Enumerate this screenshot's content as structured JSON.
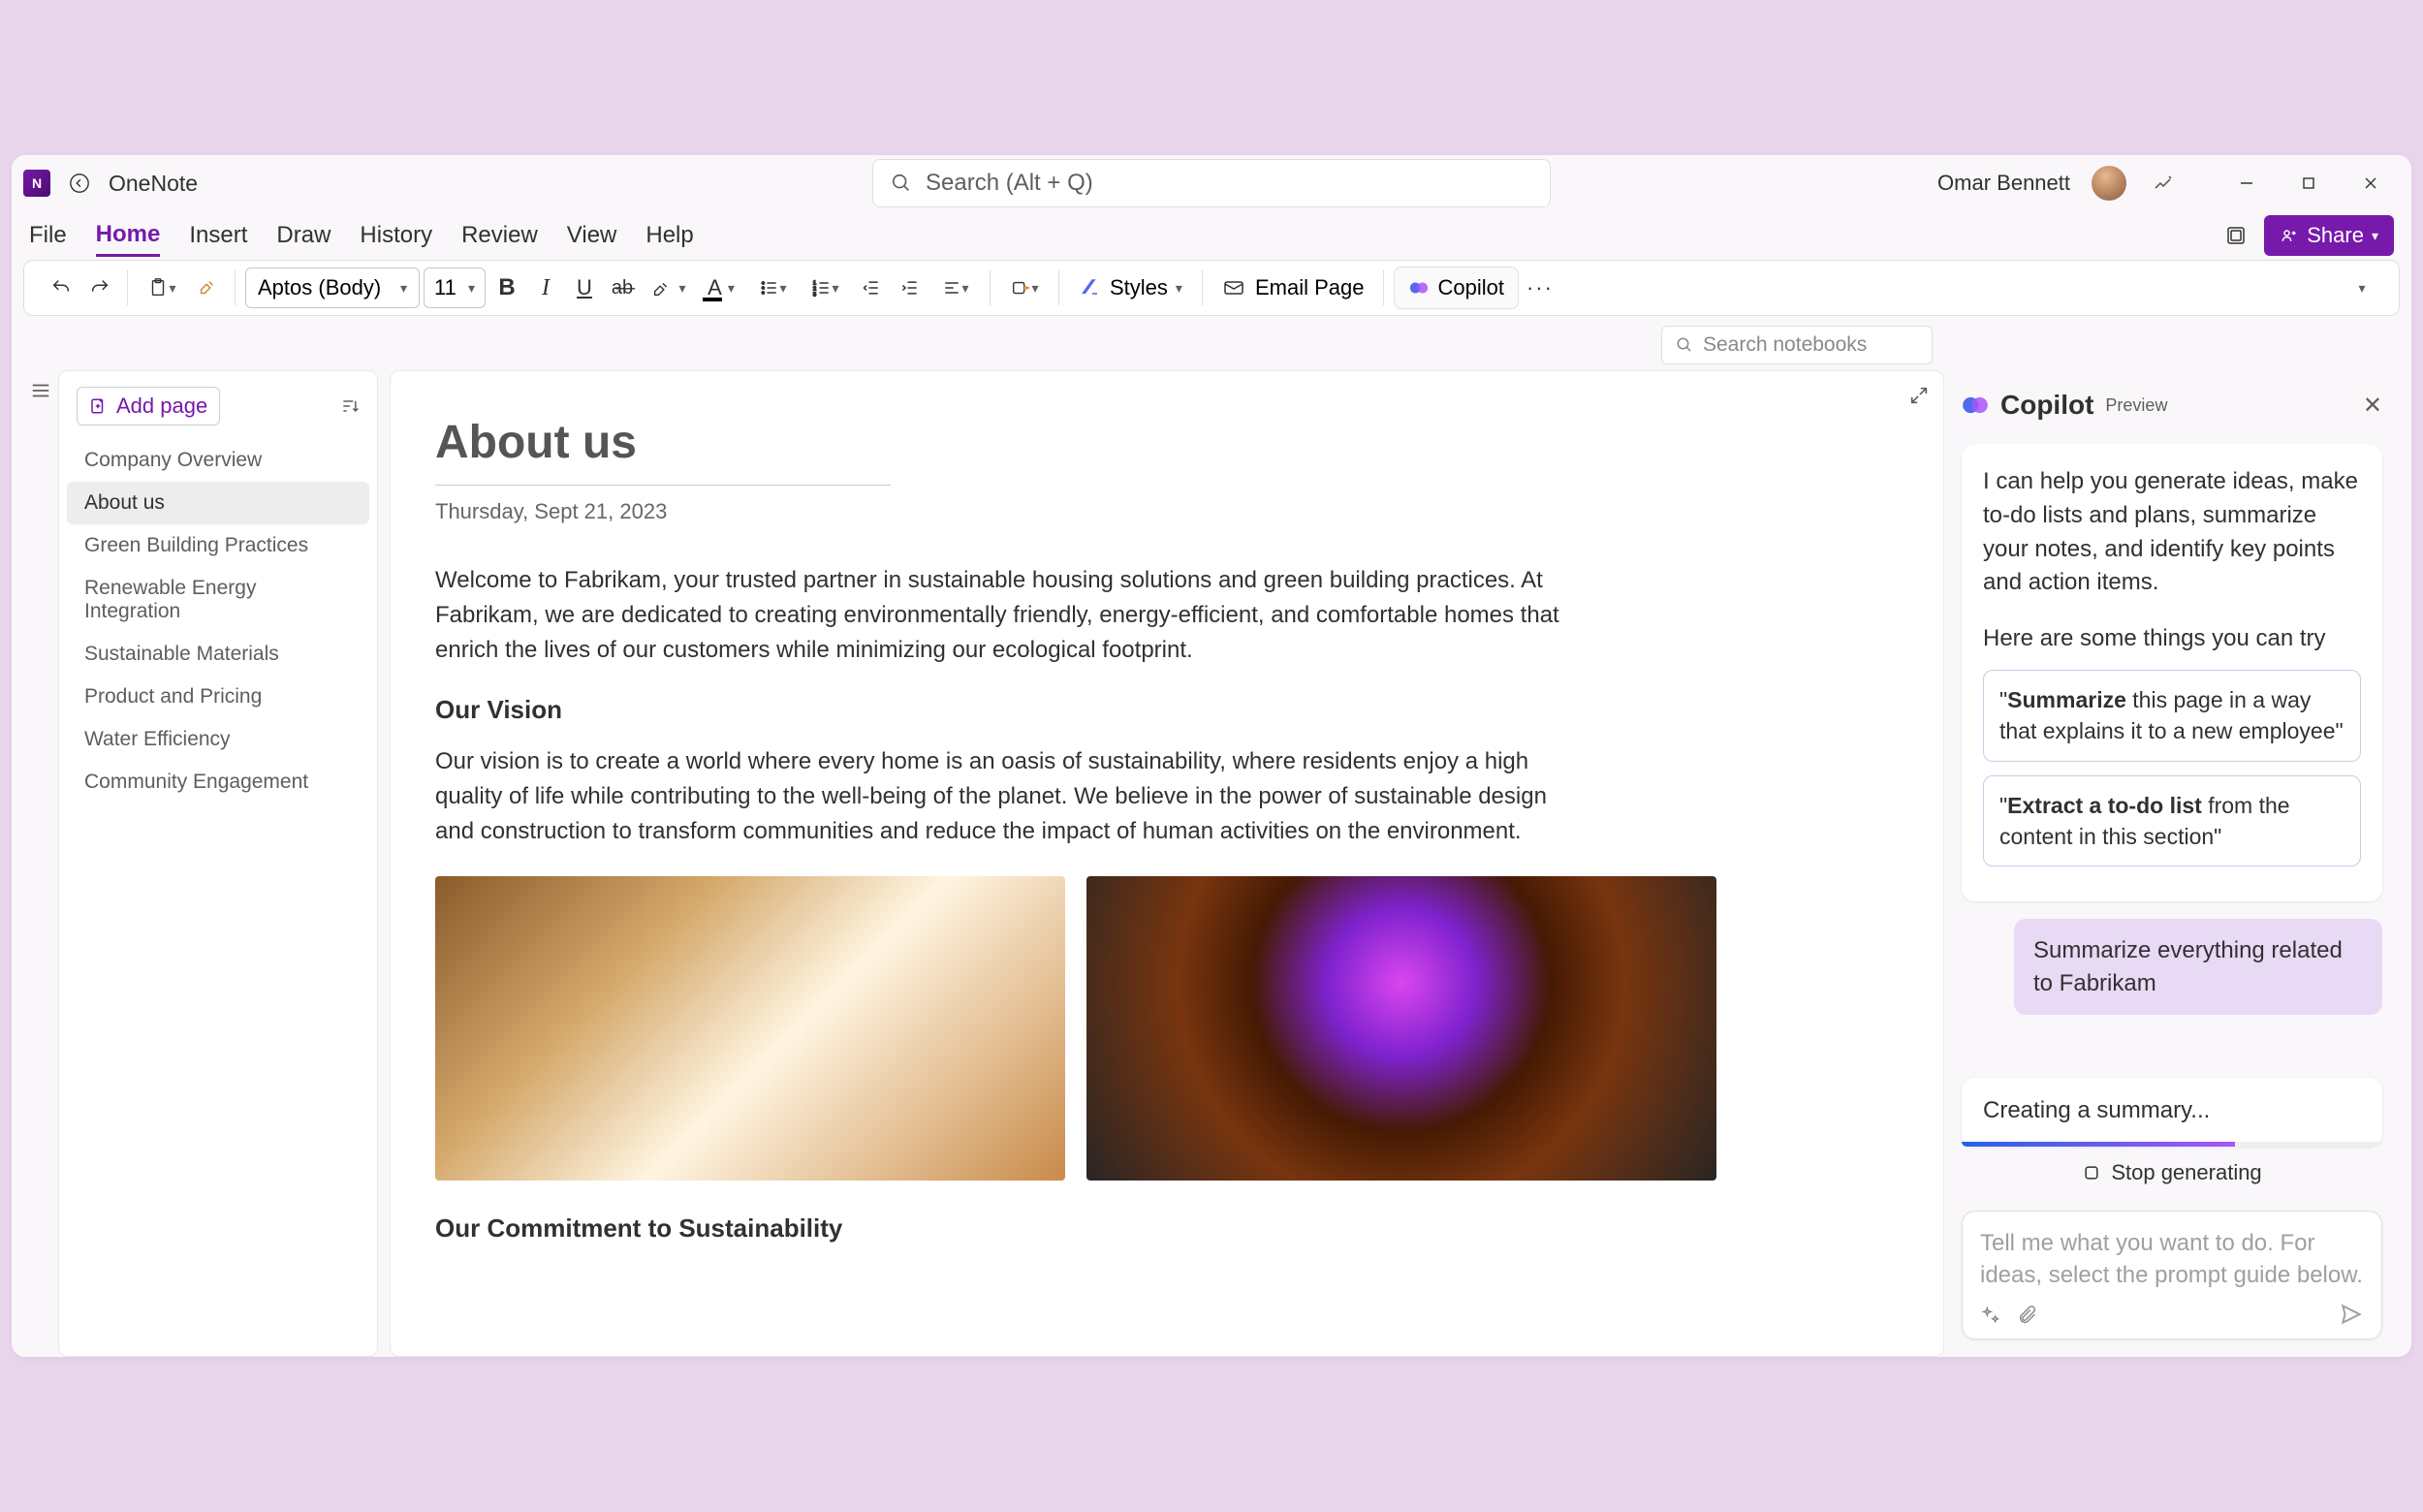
{
  "app": {
    "name": "OneNote"
  },
  "user": {
    "name": "Omar Bennett"
  },
  "search": {
    "placeholder": "Search (Alt + Q)"
  },
  "tabs": [
    "File",
    "Home",
    "Insert",
    "Draw",
    "History",
    "Review",
    "View",
    "Help"
  ],
  "active_tab": "Home",
  "share_label": "Share",
  "toolbar": {
    "font_name": "Aptos (Body)",
    "font_size": "11",
    "styles_label": "Styles",
    "email_label": "Email Page",
    "copilot_label": "Copilot"
  },
  "search_notebooks_placeholder": "Search notebooks",
  "sidebar": {
    "add_page": "Add page",
    "pages": [
      {
        "label": "Company Overview",
        "active": false
      },
      {
        "label": "About us",
        "active": true
      },
      {
        "label": "Green Building Practices",
        "active": false
      },
      {
        "label": "Renewable Energy Integration",
        "active": false
      },
      {
        "label": "Sustainable Materials",
        "active": false
      },
      {
        "label": "Product and Pricing",
        "active": false
      },
      {
        "label": "Water Efficiency",
        "active": false
      },
      {
        "label": "Community Engagement",
        "active": false
      }
    ]
  },
  "page": {
    "title": "About us",
    "date": "Thursday, Sept 21, 2023",
    "para1": "Welcome to Fabrikam, your trusted partner in sustainable housing solutions and green building practices. At Fabrikam, we are dedicated to creating environmentally friendly, energy-efficient, and comfortable homes that enrich the lives of our customers while minimizing our ecological footprint.",
    "h_vision": "Our Vision",
    "para2": "Our vision is to create a world where every home is an oasis of sustainability, where residents enjoy a high quality of life while contributing to the well-being of the planet. We believe in the power of sustainable design and construction to transform communities and reduce the impact of human activities on the environment.",
    "h_commit": "Our Commitment to Sustainability"
  },
  "copilot": {
    "title": "Copilot",
    "preview": "Preview",
    "intro": "I can help you generate ideas, make to-do lists and plans, summarize your notes, and identify key points and action items.",
    "try": "Here are some things you can try",
    "s1_bold": "Summarize",
    "s1_rest": " this page in a way that explains it to a new employee\"",
    "s1_prefix": "\"",
    "s2_bold": "Extract a to-do list",
    "s2_rest": " from the content in this section\"",
    "s2_prefix": "\"",
    "user_msg": "Summarize everything related to Fabrikam",
    "progress": "Creating a summary...",
    "stop": "Stop generating",
    "input_placeholder": "Tell me what you want to do. For ideas, select the prompt guide below."
  }
}
